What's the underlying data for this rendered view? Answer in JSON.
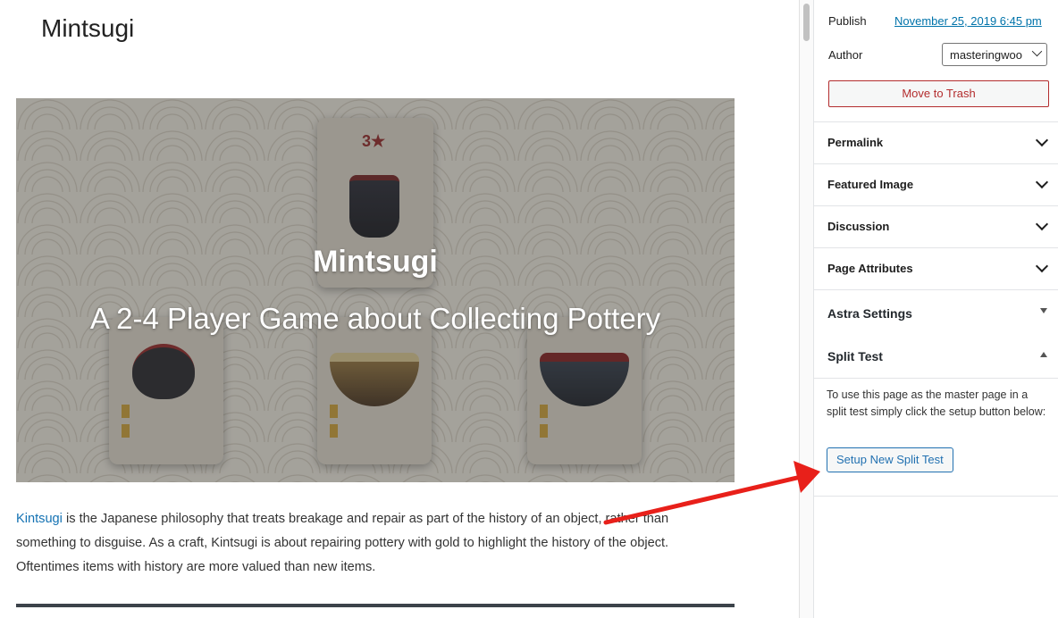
{
  "editor": {
    "site_title": "Mintsugi",
    "hero": {
      "title": "Mintsugi",
      "subtitle": "A 2-4 Player Game about Collecting Pottery",
      "card_stars": "3★"
    },
    "paragraph": {
      "link_text": "Kintsugi",
      "text": " is the Japanese philosophy that treats breakage and repair as part of the history of an object, rather than something to disguise. As a craft, Kintsugi is about repairing pottery with gold to highlight the history of the object. Oftentimes items with history are more valued than new items."
    }
  },
  "sidebar": {
    "publish_label": "Publish",
    "publish_date": "November 25, 2019 6:45 pm",
    "author_label": "Author",
    "author_value": "masteringwoo",
    "trash_label": "Move to Trash",
    "panels": {
      "permalink": "Permalink",
      "featured_image": "Featured Image",
      "discussion": "Discussion",
      "page_attributes": "Page Attributes"
    },
    "astra_settings": "Astra Settings",
    "split_test": {
      "title": "Split Test",
      "description": "To use this page as the master page in a split test simply click the setup button below:",
      "button_label": "Setup New Split Test"
    }
  },
  "colors": {
    "link": "#0073aa",
    "trash": "#b32d2e",
    "button_accent": "#2271b1",
    "annotation_arrow": "#e8201a"
  }
}
